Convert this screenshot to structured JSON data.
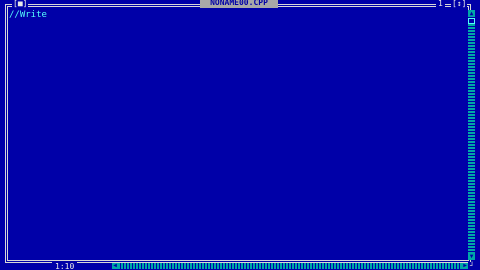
{
  "window": {
    "title": "NONAME00.CPP",
    "close_box": "[■]",
    "window_number": "1",
    "zoom_box": "[↕]"
  },
  "editor": {
    "lines": [
      "//Write"
    ]
  },
  "status": {
    "cursor_position": "1:10"
  },
  "colors": {
    "background": "#0000a8",
    "frame": "#d8d8d8",
    "text": "#54fcfc",
    "scrollbar": "#00a8a8"
  },
  "icons": {
    "close": "close-box-icon",
    "zoom": "zoom-box-icon",
    "scroll_up": "arrow-up-icon",
    "scroll_down": "arrow-down-icon",
    "scroll_left": "arrow-left-icon",
    "scroll_right": "arrow-right-icon",
    "resize": "resize-corner-icon"
  }
}
